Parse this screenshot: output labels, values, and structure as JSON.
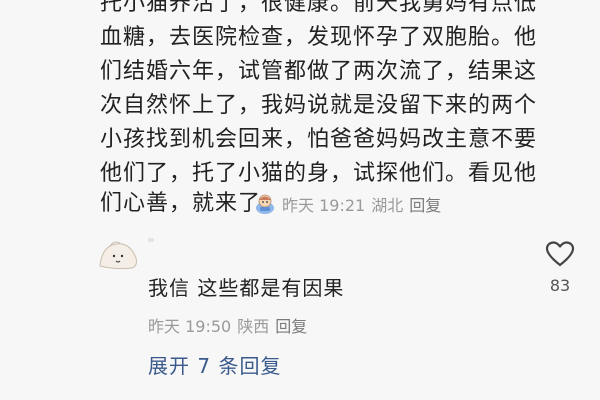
{
  "comment": {
    "lines": [
      "托小猫养活了，很健康。前天我舅妈有点低",
      "血糖，去医院检查，发现怀孕了双胞胎。他",
      "们结婚六年，试管都做了两次流了，结果这",
      "次自然怀上了，我妈说就是没留下来的两个",
      "小孩找到机会回来，怕爸爸妈妈改主意不要",
      "他们了，托了小猫的身，试探他们。看见他",
      "们心善，就来了"
    ],
    "emoji": "doll-emoji",
    "time": "昨天 19:21",
    "location": "湖北",
    "reply_label": "回复"
  },
  "like": {
    "icon": "heart-outline-icon",
    "count": "83"
  },
  "reply": {
    "avatar_icon": "avatar-doodle-icon",
    "text": "我信 这些都是有因果",
    "time": "昨天 19:50",
    "location": "陕西",
    "reply_label": "回复"
  },
  "expand": {
    "label": "展开 7 条回复"
  },
  "colors": {
    "background": "#f7f7f7",
    "text": "#222222",
    "meta": "#9a9a9a",
    "link": "#3a5a8c"
  }
}
